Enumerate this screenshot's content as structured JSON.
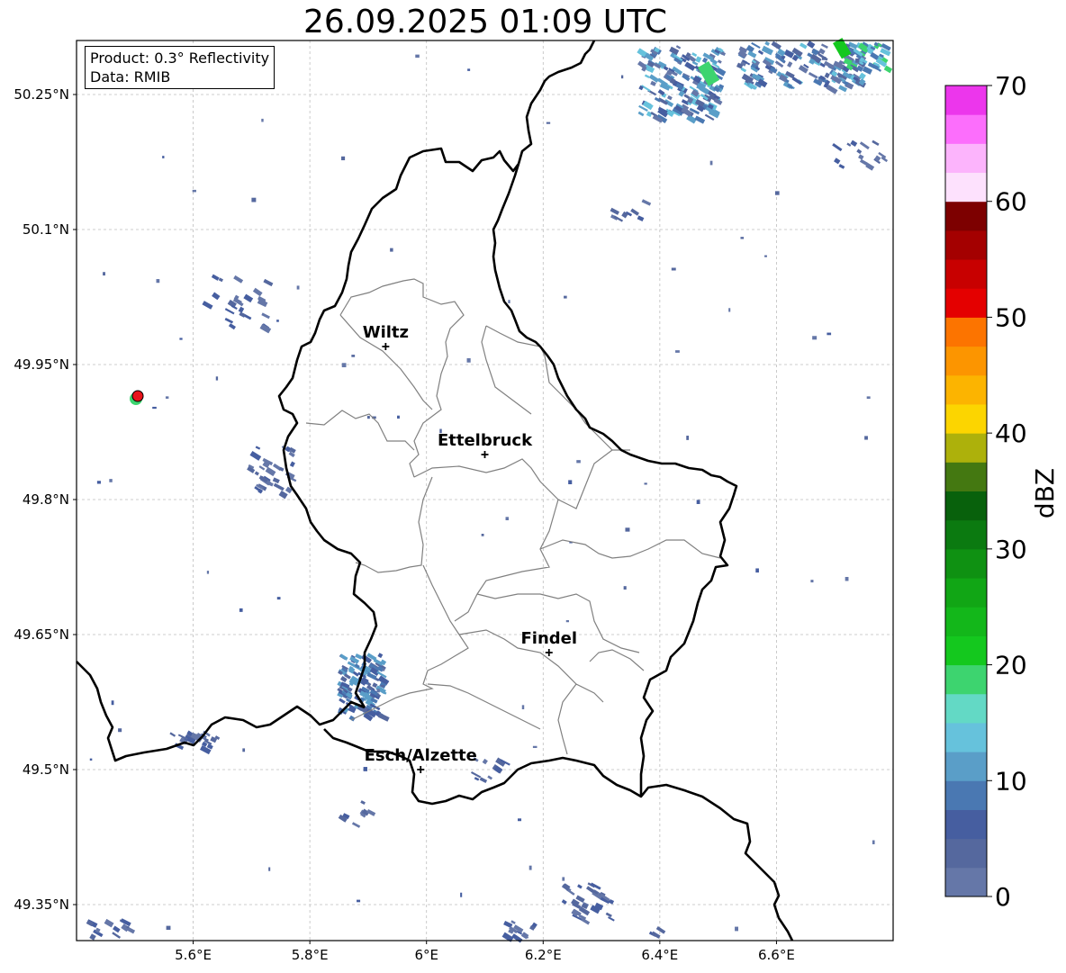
{
  "title": "26.09.2025 01:09 UTC",
  "info": {
    "product": "Product: 0.3° Reflectivity",
    "data_source": "Data: RMIB"
  },
  "map": {
    "lon_range": [
      5.4,
      6.8
    ],
    "lat_range": [
      49.31,
      50.31
    ],
    "lat_ticks": [
      {
        "value": 50.25,
        "label": "50.25°N"
      },
      {
        "value": 50.1,
        "label": "50.1°N"
      },
      {
        "value": 49.95,
        "label": "49.95°N"
      },
      {
        "value": 49.8,
        "label": "49.8°N"
      },
      {
        "value": 49.65,
        "label": "49.65°N"
      },
      {
        "value": 49.5,
        "label": "49.5°N"
      },
      {
        "value": 49.35,
        "label": "49.35°N"
      }
    ],
    "lon_ticks": [
      {
        "value": 5.6,
        "label": "5.6°E"
      },
      {
        "value": 5.8,
        "label": "5.8°E"
      },
      {
        "value": 6.0,
        "label": "6°E"
      },
      {
        "value": 6.2,
        "label": "6.2°E"
      },
      {
        "value": 6.4,
        "label": "6.4°E"
      },
      {
        "value": 6.6,
        "label": "6.6°E"
      }
    ],
    "grid": true,
    "cities": [
      {
        "name": "Wiltz",
        "lon": 5.93,
        "lat": 49.97
      },
      {
        "name": "Ettelbruck",
        "lon": 6.1,
        "lat": 49.85
      },
      {
        "name": "Findel",
        "lon": 6.21,
        "lat": 49.63
      },
      {
        "name": "Esch/Alzette",
        "lon": 5.99,
        "lat": 49.5
      }
    ],
    "radar_site": {
      "lon": 5.505,
      "lat": 49.915,
      "color": "#e8141b"
    }
  },
  "colorbar": {
    "label": "dBZ",
    "ticks": [
      "0",
      "10",
      "20",
      "30",
      "40",
      "50",
      "60",
      "70"
    ],
    "min": 0,
    "max": 70,
    "step": 2.5,
    "colors": [
      "#6577a8",
      "#55689e",
      "#465ea0",
      "#4a78b2",
      "#5a9ec8",
      "#66c2dc",
      "#63d9c5",
      "#3dd46f",
      "#14c81e",
      "#13b71a",
      "#11a615",
      "#0f9112",
      "#0b7a10",
      "#08610c",
      "#447811",
      "#adb10b",
      "#fcd500",
      "#fcb400",
      "#fc9500",
      "#fc7400",
      "#e40000",
      "#c80000",
      "#a40000",
      "#7d0000",
      "#fde1fd",
      "#fcb4fc",
      "#fc6efc",
      "#ec36ec"
    ]
  }
}
